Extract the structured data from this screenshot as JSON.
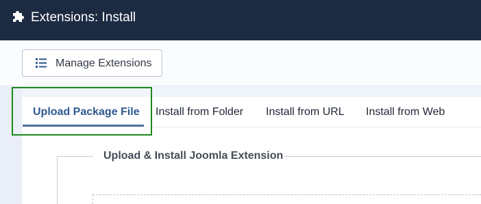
{
  "header": {
    "title": "Extensions: Install",
    "icon": "puzzle-icon"
  },
  "toolbar": {
    "manage_label": "Manage Extensions",
    "manage_icon": "list-icon"
  },
  "tabs": [
    {
      "label": "Upload Package File",
      "active": true
    },
    {
      "label": "Install from Folder",
      "active": false
    },
    {
      "label": "Install from URL",
      "active": false
    },
    {
      "label": "Install from Web",
      "active": false
    }
  ],
  "upload": {
    "legend": "Upload & Install Joomla Extension"
  },
  "colors": {
    "header_bg": "#1c2b42",
    "active_tab": "#2d5a8f",
    "highlight": "#1a8a1a"
  }
}
